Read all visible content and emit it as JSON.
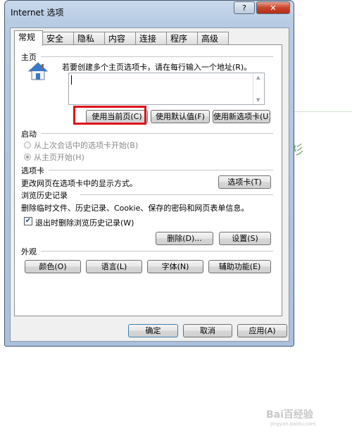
{
  "window": {
    "title": "Internet 选项",
    "help_label": "?",
    "close_label": "✕"
  },
  "tabs": [
    "常规",
    "安全",
    "隐私",
    "内容",
    "连接",
    "程序",
    "高级"
  ],
  "home": {
    "heading": "主页",
    "description": "若要创建多个主页选项卡，请在每行输入一个地址(R)。",
    "value": "",
    "buttons": [
      "使用当前页(C)",
      "使用默认值(F)",
      "使用新选项卡(U)"
    ]
  },
  "startup": {
    "heading": "启动",
    "options": [
      "从上次会话中的选项卡开始(B)",
      "从主页开始(H)"
    ]
  },
  "tab_section": {
    "heading": "选项卡",
    "description": "更改网页在选项卡中的显示方式。",
    "button": "选项卡(T)"
  },
  "history": {
    "heading": "浏览历史记录",
    "description": "删除临时文件、历史记录、Cookie、保存的密码和网页表单信息。",
    "checkbox_label": "退出时删除浏览历史记录(W)",
    "checkbox_checked": true,
    "buttons": [
      "删除(D)...",
      "设置(S)"
    ]
  },
  "appearance": {
    "heading": "外观",
    "buttons": [
      "颜色(O)",
      "语言(L)",
      "字体(N)",
      "辅助功能(E)"
    ]
  },
  "footer": {
    "buttons": [
      "确定",
      "取消",
      "应用(A)"
    ]
  },
  "background": {
    "edge_glyph": "衫"
  },
  "watermark": {
    "brand": "Bai百经验",
    "url": "jingyan.baidu.com"
  },
  "colors": {
    "highlight": "#e0101a",
    "title_bar": "#b7cbe3",
    "close_button": "#c8442a"
  },
  "icons": {
    "home_icon": "house-icon"
  }
}
